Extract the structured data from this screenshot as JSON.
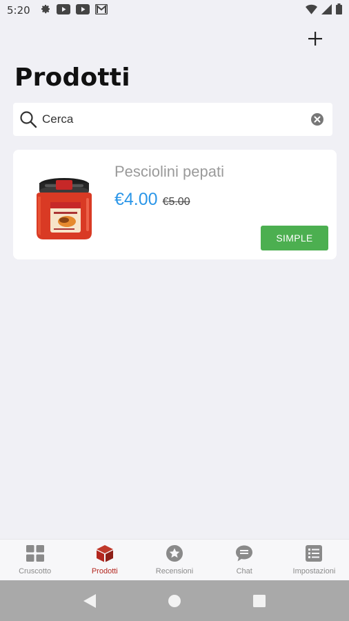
{
  "status_bar": {
    "time": "5:20",
    "left_icons": [
      "gear-icon",
      "youtube-icon",
      "youtube-icon",
      "gmail-icon"
    ],
    "right_icons": [
      "wifi-icon",
      "signal-icon",
      "battery-icon"
    ]
  },
  "header": {
    "title": "Prodotti",
    "add_icon": "plus-icon"
  },
  "search": {
    "placeholder": "Cerca",
    "value": ""
  },
  "products": [
    {
      "name": "Pesciolini pepati",
      "price": "€4.00",
      "regular_price": "€5.00",
      "type_label": "SIMPLE"
    }
  ],
  "tabs": [
    {
      "label": "Cruscotto",
      "icon": "dashboard-icon",
      "active": false
    },
    {
      "label": "Prodotti",
      "icon": "box-icon",
      "active": true
    },
    {
      "label": "Recensioni",
      "icon": "star-icon",
      "active": false
    },
    {
      "label": "Chat",
      "icon": "chat-icon",
      "active": false
    },
    {
      "label": "Impostazioni",
      "icon": "list-icon",
      "active": false
    }
  ],
  "colors": {
    "background": "#f0f0f5",
    "price_blue": "#2b96e8",
    "simple_green": "#4caf50",
    "active_tab_red": "#b3261e",
    "inactive_tab_gray": "#8a8a8a",
    "nav_bar_gray": "#a9a9a9"
  }
}
